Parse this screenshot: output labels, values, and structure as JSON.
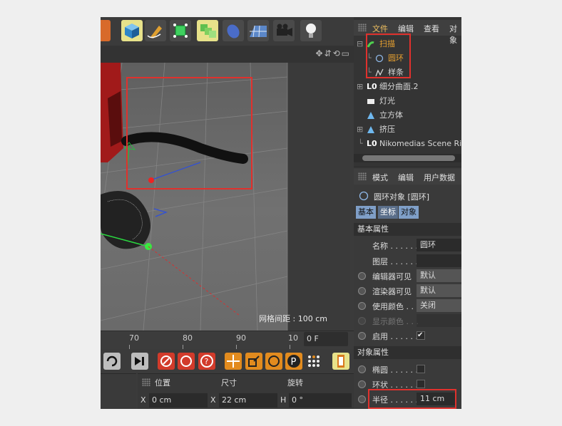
{
  "viewport": {
    "grid_label": "网格间距 : 100 cm",
    "nav_icons": "✥⇵⟲▭"
  },
  "timeline": {
    "ticks": [
      "70",
      "80",
      "90",
      "10"
    ],
    "frame": "0 F"
  },
  "coords": {
    "headers": [
      "位置",
      "尺寸",
      "旋转"
    ],
    "axes": [
      "X",
      "X",
      "H"
    ],
    "values": [
      "0 cm",
      "22 cm",
      "0 °"
    ]
  },
  "object_manager": {
    "menu": [
      "文件",
      "编辑",
      "查看",
      "对象"
    ],
    "items": [
      {
        "label": "扫描",
        "color": "#e6a030"
      },
      {
        "label": "圆环",
        "color": "#e6a030"
      },
      {
        "label": "样条",
        "color": "#d8d8d8"
      },
      {
        "label": "细分曲面.2",
        "color": "#d8d8d8"
      },
      {
        "label": "灯光",
        "color": "#d8d8d8"
      },
      {
        "label": "立方体",
        "color": "#d8d8d8"
      },
      {
        "label": "挤压",
        "color": "#d8d8d8"
      },
      {
        "label": "Nikomedias Scene Rig",
        "color": "#d8d8d8"
      }
    ]
  },
  "attributes": {
    "menu": [
      "模式",
      "编辑",
      "用户数据"
    ],
    "title": "圆环对象 [圆环]",
    "tabs": [
      "基本",
      "坐标",
      "对象"
    ],
    "section_basic": "基本属性",
    "basic": [
      {
        "label": "名称 . . . . . . .",
        "value": "圆环"
      },
      {
        "label": "图层 . . . . . . .",
        "value": ""
      },
      {
        "label": "编辑器可见",
        "value": "默认"
      },
      {
        "label": "渲染器可见",
        "value": "默认"
      },
      {
        "label": "使用颜色 . . .",
        "value": "关闭"
      },
      {
        "label": "显示颜色 . . .",
        "value": ""
      },
      {
        "label": "启用 . . . . . . .",
        "value": "✔"
      }
    ],
    "section_object": "对象属性",
    "object": [
      {
        "label": "椭圆 . . . . . . ."
      },
      {
        "label": "环状 . . . . . . ."
      },
      {
        "label": "半径 . . . . . .",
        "value": "11 cm"
      }
    ]
  }
}
